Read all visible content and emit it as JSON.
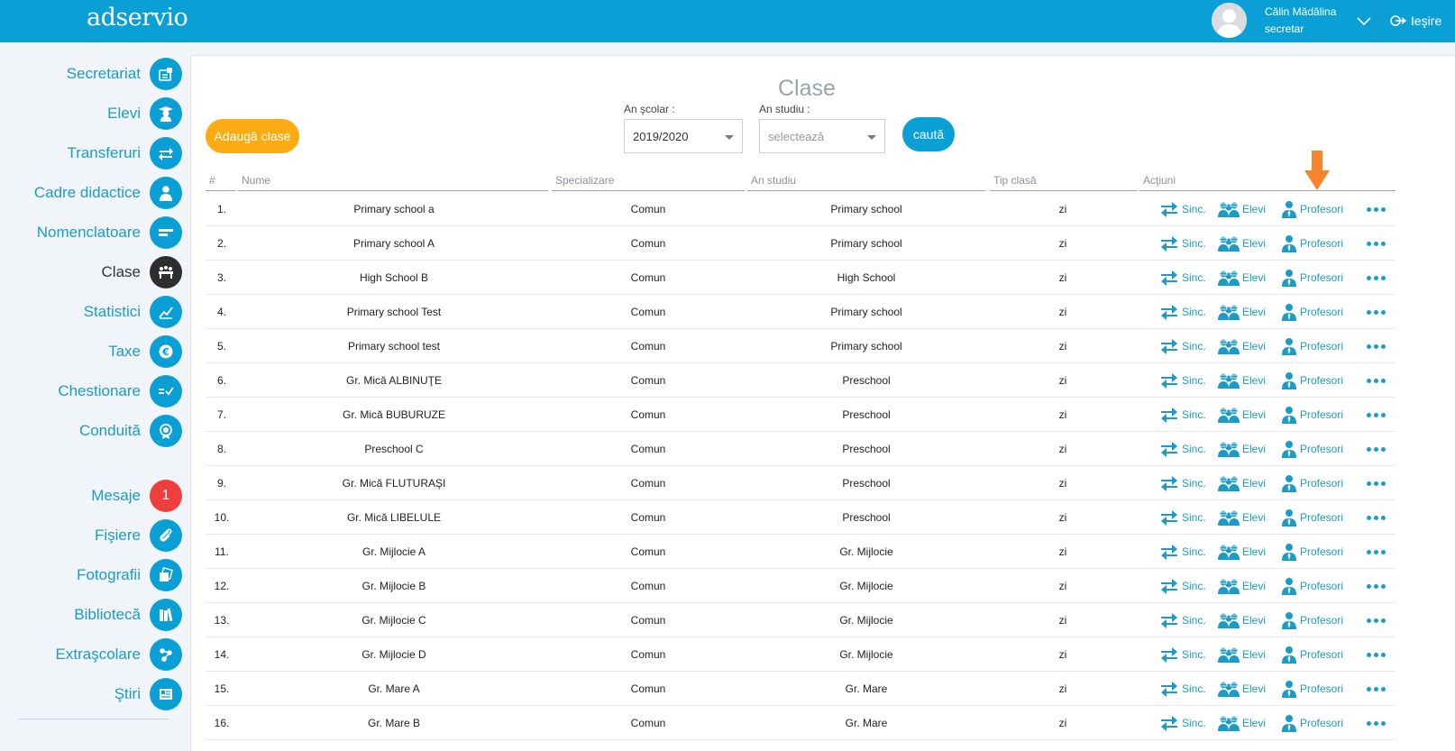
{
  "app": {
    "logo": "adservio"
  },
  "user": {
    "name": "Călin Mădălina",
    "role": "secretar",
    "logout_label": "Ieşire"
  },
  "sidebar": {
    "items": [
      {
        "label": "Secretariat",
        "icon": "id-card-icon"
      },
      {
        "label": "Elevi",
        "icon": "graduate-icon"
      },
      {
        "label": "Transferuri",
        "icon": "transfer-arrows-icon"
      },
      {
        "label": "Cadre didactice",
        "icon": "teacher-icon"
      },
      {
        "label": "Nomenclatoare",
        "icon": "list-bars-icon"
      },
      {
        "label": "Clase",
        "icon": "classroom-icon",
        "active": true
      },
      {
        "label": "Statistici",
        "icon": "trend-chart-icon"
      },
      {
        "label": "Taxe",
        "icon": "euro-icon"
      },
      {
        "label": "Chestionare",
        "icon": "equals-check-icon"
      },
      {
        "label": "Conduită",
        "icon": "award-icon"
      },
      {
        "label": "Mesaje",
        "icon": "badge",
        "badge": "1"
      },
      {
        "label": "Fişiere",
        "icon": "paperclip-icon"
      },
      {
        "label": "Fotografii",
        "icon": "photos-icon"
      },
      {
        "label": "Bibliotecă",
        "icon": "books-icon"
      },
      {
        "label": "Extraşcolare",
        "icon": "molecule-icon"
      },
      {
        "label": "Ştiri",
        "icon": "newspaper-icon"
      }
    ]
  },
  "page": {
    "title": "Clase",
    "add_button": "Adaugă clase",
    "school_year_label": "An şcolar :",
    "school_year_value": "2019/2020",
    "study_year_label": "An studiu :",
    "study_year_placeholder": "selectează",
    "search_button": "caută"
  },
  "table": {
    "headers": {
      "num": "#",
      "name": "Nume",
      "spec": "Specializare",
      "year": "An studiu",
      "type": "Tip clasă",
      "actions": "Acţiuni"
    },
    "action_labels": {
      "sync": "Sinc.",
      "students": "Elevi",
      "teachers": "Profesori"
    },
    "rows": [
      {
        "num": "1.",
        "name": "Primary school a",
        "spec": "Comun",
        "year": "Primary school",
        "type": "zi"
      },
      {
        "num": "2.",
        "name": "Primary school A",
        "spec": "Comun",
        "year": "Primary school",
        "type": "zi"
      },
      {
        "num": "3.",
        "name": "High School B",
        "spec": "Comun",
        "year": "High School",
        "type": "zi"
      },
      {
        "num": "4.",
        "name": "Primary school Test",
        "spec": "Comun",
        "year": "Primary school",
        "type": "zi"
      },
      {
        "num": "5.",
        "name": "Primary school test",
        "spec": "Comun",
        "year": "Primary school",
        "type": "zi"
      },
      {
        "num": "6.",
        "name": "Gr. Mică ALBINUŢE",
        "spec": "Comun",
        "year": "Preschool",
        "type": "zi"
      },
      {
        "num": "7.",
        "name": "Gr. Mică BUBURUZE",
        "spec": "Comun",
        "year": "Preschool",
        "type": "zi"
      },
      {
        "num": "8.",
        "name": "Preschool C",
        "spec": "Comun",
        "year": "Preschool",
        "type": "zi"
      },
      {
        "num": "9.",
        "name": "Gr. Mică FLUTURAŞI",
        "spec": "Comun",
        "year": "Preschool",
        "type": "zi"
      },
      {
        "num": "10.",
        "name": "Gr. Mică LIBELULE",
        "spec": "Comun",
        "year": "Preschool",
        "type": "zi"
      },
      {
        "num": "11.",
        "name": "Gr. Mijlocie A",
        "spec": "Comun",
        "year": "Gr. Mijlocie",
        "type": "zi"
      },
      {
        "num": "12.",
        "name": "Gr. Mijlocie B",
        "spec": "Comun",
        "year": "Gr. Mijlocie",
        "type": "zi"
      },
      {
        "num": "13.",
        "name": "Gr. Mijlocie C",
        "spec": "Comun",
        "year": "Gr. Mijlocie",
        "type": "zi"
      },
      {
        "num": "14.",
        "name": "Gr. Mijlocie D",
        "spec": "Comun",
        "year": "Gr. Mijlocie",
        "type": "zi"
      },
      {
        "num": "15.",
        "name": "Gr. Mare A",
        "spec": "Comun",
        "year": "Gr. Mare",
        "type": "zi"
      },
      {
        "num": "16.",
        "name": "Gr. Mare B",
        "spec": "Comun",
        "year": "Gr. Mare",
        "type": "zi"
      }
    ]
  },
  "colors": {
    "brand": "#0aa0d6",
    "accent_orange": "#fbac12",
    "badge_red": "#ee3e3e",
    "arrow_orange": "#f5842a"
  }
}
